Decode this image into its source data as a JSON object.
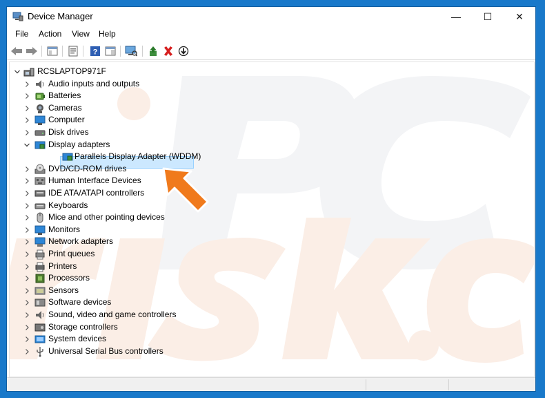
{
  "window": {
    "title": "Device Manager",
    "minimize_glyph": "—",
    "maximize_glyph": "☐",
    "close_glyph": "✕"
  },
  "menu": [
    "File",
    "Action",
    "View",
    "Help"
  ],
  "toolbar": {
    "icons": [
      "back-icon",
      "forward-icon",
      "show-hide-console-tree-icon",
      "properties-icon",
      "help-icon",
      "action-pane-icon",
      "scan-hardware-icon",
      "update-driver-icon",
      "uninstall-icon",
      "disable-device-icon"
    ]
  },
  "tree": {
    "root": "RCSLAPTOP971F",
    "categories": [
      {
        "label": "Audio inputs and outputs",
        "icon": "speaker-icon",
        "expanded": false
      },
      {
        "label": "Batteries",
        "icon": "battery-icon",
        "expanded": false
      },
      {
        "label": "Cameras",
        "icon": "camera-icon",
        "expanded": false
      },
      {
        "label": "Computer",
        "icon": "computer-icon",
        "expanded": false
      },
      {
        "label": "Disk drives",
        "icon": "disk-drive-icon",
        "expanded": false
      },
      {
        "label": "Display adapters",
        "icon": "display-adapter-icon",
        "expanded": true
      },
      {
        "label": "Parallels Display Adapter (WDDM)",
        "icon": "display-adapter-icon",
        "child": true,
        "selected": true
      },
      {
        "label": "DVD/CD-ROM drives",
        "icon": "dvd-drive-icon",
        "expanded": false
      },
      {
        "label": "Human Interface Devices",
        "icon": "hid-icon",
        "expanded": false
      },
      {
        "label": "IDE ATA/ATAPI controllers",
        "icon": "ide-controller-icon",
        "expanded": false
      },
      {
        "label": "Keyboards",
        "icon": "keyboard-icon",
        "expanded": false
      },
      {
        "label": "Mice and other pointing devices",
        "icon": "mouse-icon",
        "expanded": false
      },
      {
        "label": "Monitors",
        "icon": "monitor-icon",
        "expanded": false
      },
      {
        "label": "Network adapters",
        "icon": "network-adapter-icon",
        "expanded": false
      },
      {
        "label": "Print queues",
        "icon": "print-queue-icon",
        "expanded": false
      },
      {
        "label": "Printers",
        "icon": "printer-icon",
        "expanded": false
      },
      {
        "label": "Processors",
        "icon": "processor-icon",
        "expanded": false
      },
      {
        "label": "Sensors",
        "icon": "sensor-icon",
        "expanded": false
      },
      {
        "label": "Software devices",
        "icon": "software-device-icon",
        "expanded": false
      },
      {
        "label": "Sound, video and game controllers",
        "icon": "sound-controller-icon",
        "expanded": false
      },
      {
        "label": "Storage controllers",
        "icon": "storage-controller-icon",
        "expanded": false
      },
      {
        "label": "System devices",
        "icon": "system-devices-icon",
        "expanded": false
      },
      {
        "label": "Universal Serial Bus controllers",
        "icon": "usb-icon",
        "expanded": false
      }
    ]
  },
  "colors": {
    "desktop": "#1979ca",
    "selection": "#cce8ff",
    "arrow": "#f07a1c"
  }
}
